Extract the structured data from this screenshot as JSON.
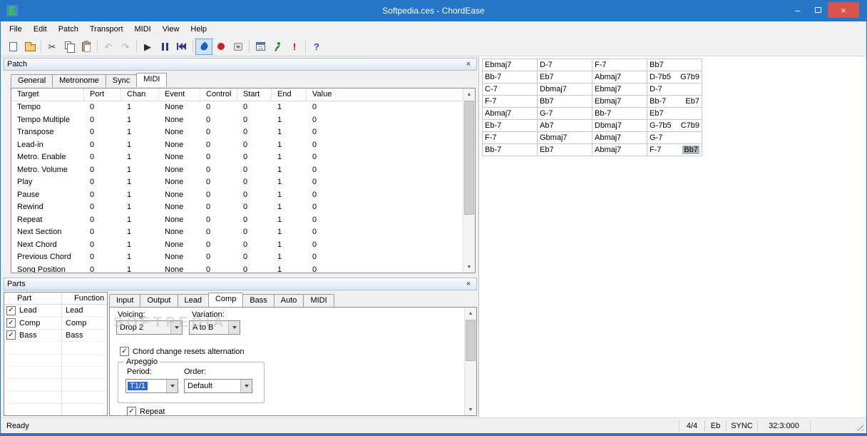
{
  "window": {
    "title": "Softpedia.ces - ChordEase"
  },
  "glyphs": {
    "close": "×",
    "minimize": "–",
    "check": "✓",
    "scroll_up": "▲",
    "scroll_down": "▼"
  },
  "menu": {
    "items": [
      "File",
      "Edit",
      "Patch",
      "Transport",
      "MIDI",
      "View",
      "Help"
    ]
  },
  "toolbar": {
    "buttons": [
      {
        "icon": "new-file"
      },
      {
        "icon": "open-file"
      },
      {
        "sep": true
      },
      {
        "icon": "cut",
        "glyph": "✂",
        "color": "#333333"
      },
      {
        "icon": "copy"
      },
      {
        "icon": "paste"
      },
      {
        "sep": true
      },
      {
        "icon": "undo",
        "glyph": "↶",
        "disabled": true
      },
      {
        "icon": "redo",
        "glyph": "↷",
        "disabled": true
      },
      {
        "sep": true
      },
      {
        "icon": "play",
        "glyph": "▶",
        "color": "#2a2a2a"
      },
      {
        "icon": "pause"
      },
      {
        "icon": "rewind"
      },
      {
        "sep": true
      },
      {
        "icon": "loop",
        "pressed": true
      },
      {
        "icon": "record"
      },
      {
        "icon": "punch"
      },
      {
        "sep": true
      },
      {
        "icon": "songbook"
      },
      {
        "icon": "practice"
      },
      {
        "icon": "panic",
        "glyph": "!",
        "color": "#cc0000",
        "bold": true
      },
      {
        "sep": true
      },
      {
        "icon": "help",
        "glyph": "?",
        "color": "#1c56b4",
        "bold": true
      }
    ]
  },
  "patch_panel": {
    "title": "Patch",
    "tabs": [
      "General",
      "Metronome",
      "Sync",
      "MIDI"
    ],
    "active_tab": "MIDI",
    "table": {
      "columns": [
        "Target",
        "Port",
        "Chan",
        "Event",
        "Control",
        "Start",
        "End",
        "Value"
      ],
      "rows": [
        [
          "Tempo",
          "0",
          "1",
          "None",
          "0",
          "0",
          "1",
          "0"
        ],
        [
          "Tempo Multiple",
          "0",
          "1",
          "None",
          "0",
          "0",
          "1",
          "0"
        ],
        [
          "Transpose",
          "0",
          "1",
          "None",
          "0",
          "0",
          "1",
          "0"
        ],
        [
          "Lead-in",
          "0",
          "1",
          "None",
          "0",
          "0",
          "1",
          "0"
        ],
        [
          "Metro. Enable",
          "0",
          "1",
          "None",
          "0",
          "0",
          "1",
          "0"
        ],
        [
          "Metro. Volume",
          "0",
          "1",
          "None",
          "0",
          "0",
          "1",
          "0"
        ],
        [
          "Play",
          "0",
          "1",
          "None",
          "0",
          "0",
          "1",
          "0"
        ],
        [
          "Pause",
          "0",
          "1",
          "None",
          "0",
          "0",
          "1",
          "0"
        ],
        [
          "Rewind",
          "0",
          "1",
          "None",
          "0",
          "0",
          "1",
          "0"
        ],
        [
          "Repeat",
          "0",
          "1",
          "None",
          "0",
          "0",
          "1",
          "0"
        ],
        [
          "Next Section",
          "0",
          "1",
          "None",
          "0",
          "0",
          "1",
          "0"
        ],
        [
          "Next Chord",
          "0",
          "1",
          "None",
          "0",
          "0",
          "1",
          "0"
        ],
        [
          "Previous Chord",
          "0",
          "1",
          "None",
          "0",
          "0",
          "1",
          "0"
        ],
        [
          "Song Position",
          "0",
          "1",
          "None",
          "0",
          "0",
          "1",
          "0"
        ]
      ]
    }
  },
  "parts_panel": {
    "title": "Parts",
    "table": {
      "columns": [
        "Part",
        "Function"
      ],
      "rows": [
        {
          "part": "Lead",
          "function": "Lead",
          "checked": true
        },
        {
          "part": "Comp",
          "function": "Comp",
          "checked": true
        },
        {
          "part": "Bass",
          "function": "Bass",
          "checked": true
        }
      ],
      "empty_rows": 6
    },
    "tabs": [
      "Input",
      "Output",
      "Lead",
      "Comp",
      "Bass",
      "Auto",
      "MIDI"
    ],
    "active_tab": "Comp",
    "comp": {
      "voicing_label": "Voicing:",
      "voicing_value": "Drop 2",
      "variation_label": "Variation:",
      "variation_value": "A to B",
      "chord_change_label": "Chord change resets alternation",
      "chord_change_checked": true,
      "arpeggio": {
        "title": "Arpeggio",
        "period_label": "Period:",
        "period_value": "T1/1",
        "order_label": "Order:",
        "order_value": "Default",
        "repeat_label": "Repeat",
        "repeat_checked": true
      }
    }
  },
  "chord_grid": {
    "rows": [
      [
        [
          "Ebmaj7"
        ],
        [
          "D-7"
        ],
        [
          "F-7"
        ],
        [
          "Bb7"
        ]
      ],
      [
        [
          "Bb-7"
        ],
        [
          "Eb7"
        ],
        [
          "Abmaj7"
        ],
        [
          "D-7b5",
          "G7b9"
        ]
      ],
      [
        [
          "C-7"
        ],
        [
          "Dbmaj7"
        ],
        [
          "Ebmaj7"
        ],
        [
          "D-7"
        ]
      ],
      [
        [
          "F-7"
        ],
        [
          "Bb7"
        ],
        [
          "Ebmaj7"
        ],
        [
          "Bb-7",
          "Eb7"
        ]
      ],
      [
        [
          "Abmaj7"
        ],
        [
          "G-7"
        ],
        [
          "Bb-7"
        ],
        [
          "Eb7"
        ]
      ],
      [
        [
          "Eb-7"
        ],
        [
          "Ab7"
        ],
        [
          "Dbmaj7"
        ],
        [
          "G-7b5",
          "C7b9"
        ]
      ],
      [
        [
          "F-7"
        ],
        [
          "Gbmaj7"
        ],
        [
          "Abmaj7"
        ],
        [
          "G-7"
        ]
      ],
      [
        [
          "Bb-7"
        ],
        [
          "Eb7"
        ],
        [
          "Abmaj7"
        ],
        [
          "F-7",
          "Bb7"
        ]
      ]
    ],
    "selected": {
      "row": 7,
      "cell": 3,
      "chord_index": 1
    }
  },
  "status_bar": {
    "ready": "Ready",
    "time_sig": "4/4",
    "key": "Eb",
    "sync": "SYNC",
    "position": "32:3:000"
  },
  "watermark": "SOFTPEDIA"
}
